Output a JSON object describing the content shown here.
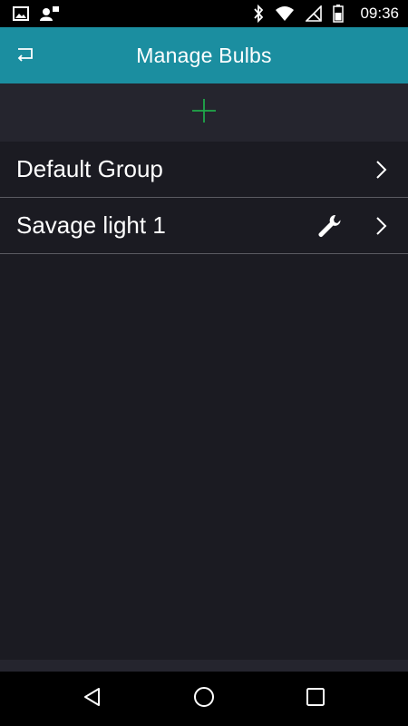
{
  "status_bar": {
    "time": "09:36",
    "left_icons": [
      "image-icon",
      "account-icon"
    ],
    "right_icons": [
      "bluetooth-icon",
      "wifi-icon",
      "no-signal-icon",
      "battery-icon"
    ]
  },
  "app_bar": {
    "title": "Manage Bulbs",
    "color": "#1b8ea0",
    "back_icon": "back-icon"
  },
  "toolbar": {
    "add_icon": "plus-icon",
    "add_color": "#1fa84a"
  },
  "list": {
    "items": [
      {
        "label": "Default Group",
        "has_settings": false
      },
      {
        "label": "Savage light 1",
        "has_settings": true
      }
    ]
  },
  "nav_bar": {
    "buttons": [
      "back-triangle-icon",
      "home-circle-icon",
      "recents-square-icon"
    ]
  }
}
